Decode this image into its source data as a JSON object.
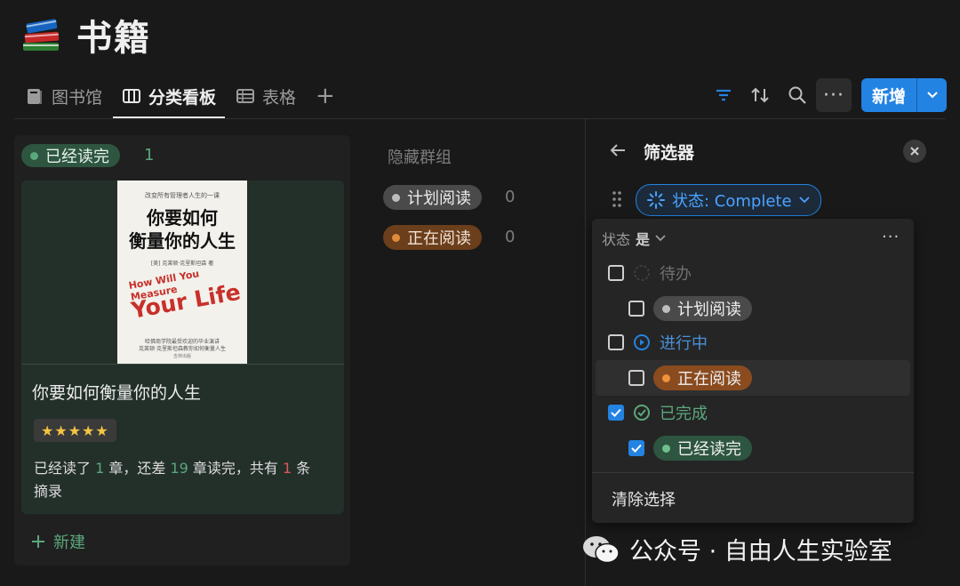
{
  "page": {
    "icon": "books-icon",
    "title": "书籍"
  },
  "tabs": [
    {
      "label": "图书馆",
      "icon": "library-icon",
      "active": false
    },
    {
      "label": "分类看板",
      "icon": "board-icon",
      "active": true
    },
    {
      "label": "表格",
      "icon": "table-icon",
      "active": false
    }
  ],
  "toolbar": {
    "add_tab": "+",
    "more": "···",
    "new_label": "新增",
    "accent": "#2383e2"
  },
  "board": {
    "group": {
      "label": "已经读完",
      "count": "1",
      "color": "#5ba77c"
    },
    "card": {
      "cover": {
        "top_line": "改变所有管理者人生的一课",
        "title_line1": "你要如何",
        "title_line2": "衡量你的人生",
        "authors": "[美] 克莱顿·克里斯坦森 著",
        "en_line1": "How Will You Measure",
        "en_line2": "Your Life",
        "blurb1": "哈佛商学院最受欢迎的毕业演讲",
        "blurb2": "克莱顿·克里斯坦森教你如何衡量人生",
        "publisher": "吉林出版"
      },
      "title": "你要如何衡量你的人生",
      "rating": "★★★★★",
      "progress": {
        "p1": "已经读了 ",
        "read": "1",
        "p2": " 章，还差 ",
        "left": "19",
        "p3": " 章读完，共有 ",
        "notes": "1",
        "p4": " 条",
        "p5": "摘录"
      }
    },
    "new_label": "新建"
  },
  "hidden": {
    "title": "隐藏群组",
    "groups": [
      {
        "label": "计划阅读",
        "count": "0",
        "color": "#9b9b9b"
      },
      {
        "label": "正在阅读",
        "count": "0",
        "color": "#d9822b"
      }
    ]
  },
  "filter": {
    "title": "筛选器",
    "chip": "状态: Complete",
    "header_prop": "状态",
    "header_op": "是",
    "more": "···",
    "options": [
      {
        "label": "待办",
        "checked": false
      },
      {
        "label": "计划阅读",
        "checked": false
      },
      {
        "label": "进行中",
        "checked": false
      },
      {
        "label": "正在阅读",
        "checked": false
      },
      {
        "label": "已完成",
        "checked": true
      },
      {
        "label": "已经读完",
        "checked": true
      }
    ],
    "clear_label": "清除选择"
  },
  "watermark": {
    "text": "公众号 · 自由人生实验室"
  }
}
